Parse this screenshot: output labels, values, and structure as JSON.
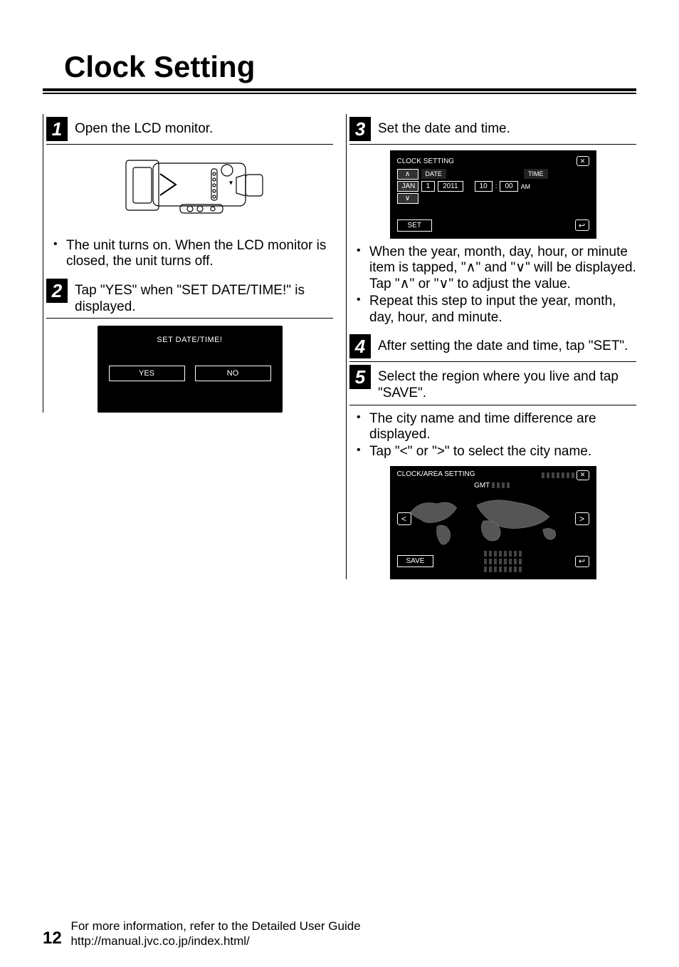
{
  "title": "Clock Setting",
  "left": {
    "step1": {
      "num": "1",
      "text": "Open the LCD monitor.",
      "bullets": [
        "The unit turns on. When the LCD monitor is closed, the unit turns off."
      ]
    },
    "step2": {
      "num": "2",
      "text": "Tap \"YES\" when \"SET DATE/TIME!\" is displayed.",
      "lcd": {
        "title": "SET DATE/TIME!",
        "yes": "YES",
        "no": "NO"
      }
    }
  },
  "right": {
    "step3": {
      "num": "3",
      "text": "Set the date and time.",
      "lcd": {
        "title": "CLOCK SETTING",
        "date_label": "DATE",
        "time_label": "TIME",
        "month": "JAN",
        "day": "1",
        "year": "2011",
        "hour": "10",
        "sep": ":",
        "minute": "00",
        "ampm": "AM",
        "set": "SET",
        "up": "∧",
        "down": "∨"
      },
      "bullets": [
        "When the year, month, day, hour, or minute item is tapped, \"∧\" and \"∨\" will be displayed. Tap \"∧\" or \"∨\" to adjust the value.",
        "Repeat this step to input the year, month, day, hour, and minute."
      ]
    },
    "step4": {
      "num": "4",
      "text": "After setting the date and time, tap \"SET\"."
    },
    "step5": {
      "num": "5",
      "text": "Select the region where you live and tap \"SAVE\".",
      "bullets": [
        "The city name and time difference are displayed.",
        "Tap \"<\" or \">\" to select the city name."
      ],
      "lcd": {
        "title": "CLOCK/AREA SETTING",
        "gmt": "GMT",
        "save": "SAVE",
        "left": "<",
        "right": ">"
      }
    }
  },
  "footer": {
    "page": "12",
    "line1": "For more information, refer to the Detailed User Guide",
    "line2": "http://manual.jvc.co.jp/index.html/"
  }
}
